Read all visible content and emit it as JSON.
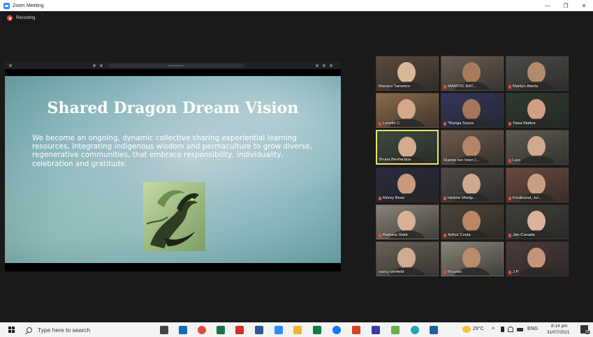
{
  "window": {
    "title": "Zoom Meeting",
    "controls": [
      "—",
      "❐",
      "✕"
    ]
  },
  "recording": {
    "label": "Recording"
  },
  "shared_screen": {
    "browser_url": "docs.google.com",
    "slide_title": "Shared Dragon Dream Vision",
    "slide_body": "We become an ongoing, dynamic collective sharing experiential learning resources, integrating indigenous wisdom and permaculture to grow diverse, regenerative communities, that embrace responsibility, individuality, celebration and gratitude."
  },
  "participants": [
    {
      "name": "Macaco Tamerice",
      "muted": false,
      "bg": "#5a4a3e",
      "skin": "#d9b89a"
    },
    {
      "name": "MARIVIC BAT...",
      "muted": true,
      "bg": "#6b5d52",
      "skin": "#a77b5c"
    },
    {
      "name": "Marilyn Abella",
      "muted": true,
      "bg": "#4b4a45",
      "skin": "#b28a6c"
    },
    {
      "name": "Lynette C",
      "muted": true,
      "bg": "#8a6a4a",
      "skin": "#d4a989"
    },
    {
      "name": "*Ranga Soysa",
      "muted": true,
      "bg": "#34365a",
      "skin": "#a5775a"
    },
    {
      "name": "Taisa Mattos",
      "muted": true,
      "bg": "#2f3a30",
      "skin": "#cfa086"
    },
    {
      "name": "Bruna Bevilacqua",
      "muted": false,
      "bg": "#3d4a3c",
      "skin": "#d4aa8e",
      "active": true
    },
    {
      "name": "Rianne ten Veen (...",
      "muted": false,
      "bg": "#6d5a4c",
      "skin": "#b48466"
    },
    {
      "name": "Lars",
      "muted": true,
      "bg": "#5e5a50",
      "skin": "#d0a88c"
    },
    {
      "name": "Morey Bean",
      "muted": true,
      "bg": "#2a2a3c",
      "skin": "#c79a7e"
    },
    {
      "name": "Helene Montp...",
      "muted": true,
      "bg": "#4e4a46",
      "skin": "#cfa88e"
    },
    {
      "name": "Ferdinand, Jul...",
      "muted": true,
      "bg": "#6a4a3e",
      "skin": "#cc9e80"
    },
    {
      "name": "Barbara Stärk",
      "muted": true,
      "bg": "#8a8378",
      "skin": "#d7b294"
    },
    {
      "name": "Arthur Costa",
      "muted": true,
      "bg": "#4d4438",
      "skin": "#b88866"
    },
    {
      "name": "Jan-Canada",
      "muted": true,
      "bg": "#3e3e3a",
      "skin": "#d9b49a"
    },
    {
      "name": "nancy winfield",
      "muted": false,
      "bg": "#6a6258",
      "skin": "#d1ab90"
    },
    {
      "name": "Ricardo",
      "muted": true,
      "bg": "#8a8478",
      "skin": "#b78c6c"
    },
    {
      "name": "J P",
      "muted": true,
      "bg": "#4c3a3a",
      "skin": "#c49478"
    }
  ],
  "taskbar": {
    "search_placeholder": "Type here to search",
    "pinned_icons": [
      {
        "name": "task-view-icon",
        "color": "#444444"
      },
      {
        "name": "mail-icon",
        "color": "#0f6cbd"
      },
      {
        "name": "chrome-icon",
        "color": "#e24c3c"
      },
      {
        "name": "excel-icon",
        "color": "#1d7044"
      },
      {
        "name": "acrobat-icon",
        "color": "#d9302a"
      },
      {
        "name": "word-icon",
        "color": "#2b5797"
      },
      {
        "name": "zoom-icon",
        "color": "#2d8cff"
      },
      {
        "name": "file-explorer-icon",
        "color": "#f0b429"
      },
      {
        "name": "publisher-icon",
        "color": "#107c41"
      },
      {
        "name": "facebook-icon",
        "color": "#1877f2"
      },
      {
        "name": "powerpoint-icon",
        "color": "#d04423"
      },
      {
        "name": "sway-icon",
        "color": "#3c3ca8"
      },
      {
        "name": "app-icon",
        "color": "#6ab04c"
      },
      {
        "name": "edge-icon",
        "color": "#1fa7b8"
      },
      {
        "name": "photos-icon",
        "color": "#1f5f9c"
      }
    ],
    "weather": "29°C",
    "language": "ENG",
    "time": "8:14 pm",
    "date": "31/07/2021",
    "notification_count": "29"
  }
}
